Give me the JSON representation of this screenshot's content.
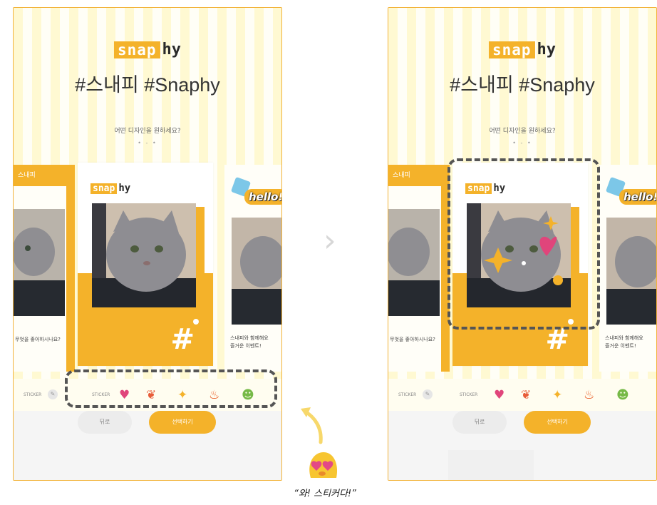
{
  "colors": {
    "accent": "#f4b22a",
    "border": "#f2b33a",
    "stripe": "#fff9d2"
  },
  "app": {
    "logo_box": "snap",
    "logo_text": "hy",
    "tagline": "#스내피 #Snaphy",
    "question": "어떤 디자인을 원하세요?",
    "pager": "• - •"
  },
  "cards": {
    "left_band": "스내피",
    "left_caption": "무엇을 좋아하시나요?",
    "center_hash": "#",
    "right_hello": "hello!",
    "right_caption_1": "스내피와 함께해요",
    "right_caption_2": "즐거운 이벤트!"
  },
  "sticker_bar": {
    "label1": "STICKER",
    "label2": "STICKER",
    "icons": [
      "heart-icon",
      "tulip-icon",
      "sparkle-icon",
      "flame-icon",
      "frog-icon"
    ]
  },
  "buttons": {
    "back": "뒤로",
    "next": "선택하기"
  },
  "nav": {
    "chevron": "›"
  },
  "caption": "“와! 스티커다!”"
}
